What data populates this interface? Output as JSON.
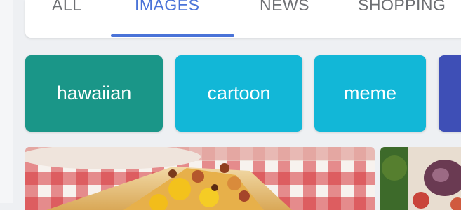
{
  "tabs": [
    {
      "label": "ALL",
      "active": false
    },
    {
      "label": "IMAGES",
      "active": true
    },
    {
      "label": "NEWS",
      "active": false
    },
    {
      "label": "SHOPPING",
      "active": false
    }
  ],
  "suggestions": [
    {
      "label": "hawaiian",
      "color": "#1a9688"
    },
    {
      "label": "cartoon",
      "color": "#12b7d7"
    },
    {
      "label": "meme",
      "color": "#12b7d7"
    },
    {
      "label": "",
      "color": "#3e4fb6"
    }
  ],
  "colors": {
    "accent": "#4a73d8",
    "inactive_tab": "#6d6f73",
    "background": "#eef0f3"
  },
  "results": [
    {
      "icon": "pizza-slice-image"
    },
    {
      "icon": "pizza-thumbnail-image"
    }
  ]
}
